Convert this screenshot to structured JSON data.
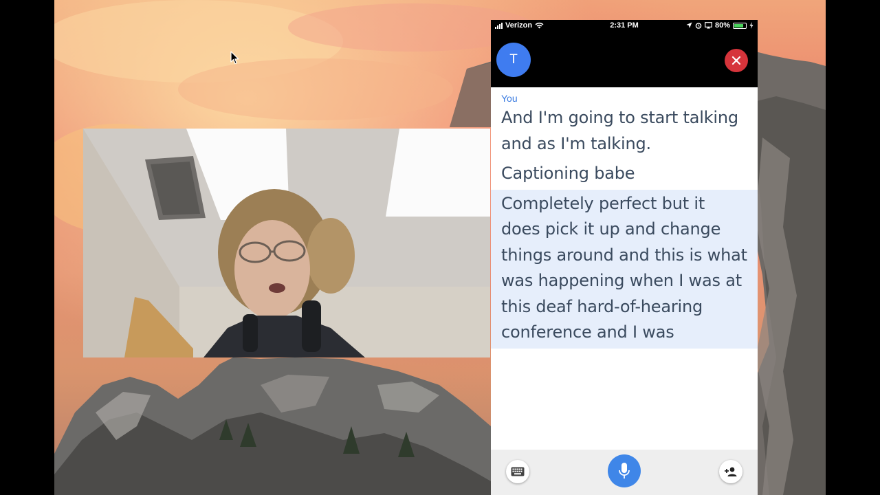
{
  "status_bar": {
    "carrier": "Verizon",
    "time": "2:31 PM",
    "battery": "80%",
    "battery_level": 0.8
  },
  "header": {
    "avatar_initial": "T",
    "close_icon": "close-icon"
  },
  "transcript": {
    "speaker_label": "You",
    "messages": [
      "And I'm going to start talking and as I'm talking.",
      "Captioning babe",
      "Completely perfect but it does pick it up and change things around and this is what was happening when I was at this deaf hard-of-hearing conference and I was"
    ]
  },
  "toolbar": {
    "keyboard_icon": "keyboard-icon",
    "mic_icon": "microphone-icon",
    "add_person_icon": "add-person-icon"
  },
  "colors": {
    "accent_blue": "#3f7cf0",
    "close_red": "#d6343b",
    "active_caption_bg": "#e6eefb",
    "speaker_label": "#3a7be0"
  }
}
